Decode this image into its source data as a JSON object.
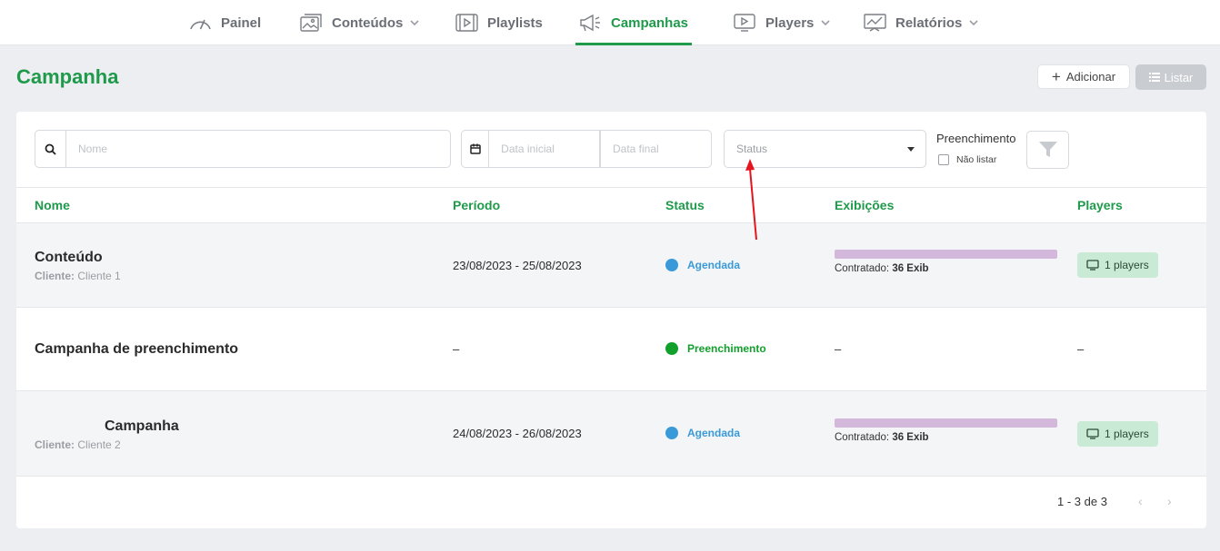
{
  "nav": {
    "items": [
      {
        "label": "Painel",
        "icon": "gauge-icon",
        "has_dropdown": false,
        "active": false
      },
      {
        "label": "Conteúdos",
        "icon": "images-icon",
        "has_dropdown": true,
        "active": false
      },
      {
        "label": "Playlists",
        "icon": "playlist-icon",
        "has_dropdown": false,
        "active": false
      },
      {
        "label": "Campanhas",
        "icon": "megaphone-icon",
        "has_dropdown": false,
        "active": true
      },
      {
        "label": "Players",
        "icon": "player-icon",
        "has_dropdown": true,
        "active": false
      },
      {
        "label": "Relatórios",
        "icon": "chart-icon",
        "has_dropdown": true,
        "active": false
      }
    ]
  },
  "page": {
    "title": "Campanha",
    "add_label": "Adicionar",
    "list_label": "Listar"
  },
  "filters": {
    "name_placeholder": "Nome",
    "date_start_placeholder": "Data inicial",
    "date_end_placeholder": "Data final",
    "status_placeholder": "Status",
    "fill_label": "Preenchimento",
    "fill_checkbox_label": "Não listar",
    "fill_checkbox_checked": false
  },
  "table": {
    "headers": {
      "name": "Nome",
      "period": "Período",
      "status": "Status",
      "views": "Exibições",
      "players": "Players"
    },
    "rows": [
      {
        "name": "Conteúdo",
        "client_label": "Cliente:",
        "client": "Cliente 1",
        "period": "23/08/2023 - 25/08/2023",
        "status": "Agendada",
        "status_color": "#3a9ad9",
        "contracted_label": "Contratado:",
        "contracted": "36 Exib",
        "players": "1 players"
      },
      {
        "name": "Campanha de preenchimento",
        "client_label": "",
        "client": "",
        "period": "–",
        "status": "Preenchimento",
        "status_color": "#12a02d",
        "views": "–",
        "players": "–"
      },
      {
        "name": "Campanha",
        "client_label": "Cliente:",
        "client": "Cliente 2",
        "period": "24/08/2023 - 26/08/2023",
        "status": "Agendada",
        "status_color": "#3a9ad9",
        "contracted_label": "Contratado:",
        "contracted": "36 Exib",
        "players": "1 players"
      }
    ]
  },
  "pagination": {
    "range": "1 - 3 de 3",
    "prev": "‹",
    "next": "›"
  },
  "colors": {
    "accent": "#1e9a4a",
    "scheduled": "#3a9ad9",
    "filler": "#12a02d",
    "views_bar": "#d3b8dc",
    "players_badge": "#c9ebd5",
    "annotation_arrow": "#e5141d"
  }
}
